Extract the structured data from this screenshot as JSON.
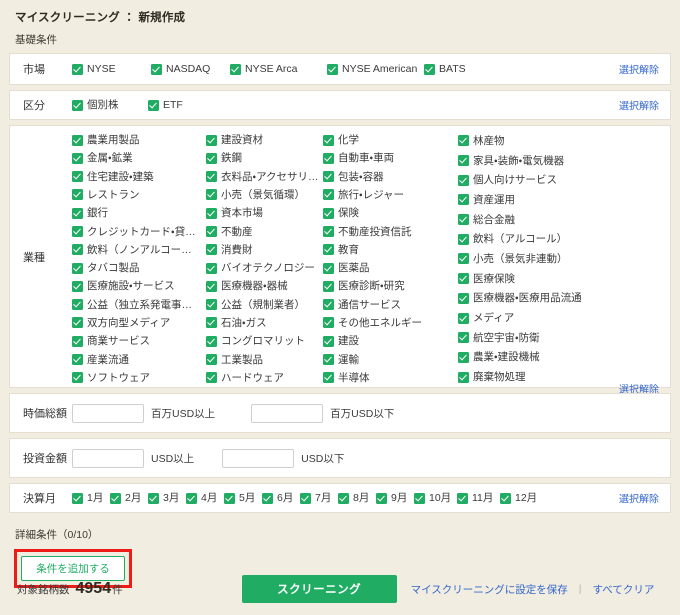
{
  "header": {
    "title": "マイスクリーニング ： 新規作成",
    "subtitle": "基礎条件"
  },
  "clear_link_label": "選択解除",
  "market": {
    "label": "市場",
    "items": [
      {
        "label": "NYSE",
        "checked": true
      },
      {
        "label": "NASDAQ",
        "checked": true
      },
      {
        "label": "NYSE Arca",
        "checked": true
      },
      {
        "label": "NYSE American",
        "checked": true
      },
      {
        "label": "BATS",
        "checked": true
      }
    ]
  },
  "kubun": {
    "label": "区分",
    "items": [
      {
        "label": "個別株",
        "checked": true
      },
      {
        "label": "ETF",
        "checked": true
      }
    ]
  },
  "industry": {
    "label": "業種",
    "columns": [
      [
        "農業用製品",
        "金属・鉱業",
        "住宅建設・建築",
        "レストラン",
        "銀行",
        "クレジットカード・貸…",
        "飲料（ノンアルコール）",
        "タバコ製品",
        "医療施設・サービス",
        "公益（独立系発電事業…",
        "双方向型メディア",
        "商業サービス",
        "産業流通",
        "ソフトウェア"
      ],
      [
        "建設資材",
        "鉄鋼",
        "衣料品・アクセサリー…",
        "小売（景気循環）",
        "資本市場",
        "不動産",
        "消費財",
        "バイオテクノロジー",
        "医療機器・器械",
        "公益（規制業者）",
        "石油・ガス",
        "コングロマリット",
        "工業製品",
        "ハードウェア"
      ],
      [
        "化学",
        "自動車・車両",
        "包装・容器",
        "旅行・レジャー",
        "保険",
        "不動産投資信託",
        "教育",
        "医薬品",
        "医療診断・研究",
        "通信サービス",
        "その他エネルギー",
        "建設",
        "運輸",
        "半導体"
      ],
      [
        "林産物",
        "家具・装飾・電気機器",
        "個人向けサービス",
        "資産運用",
        "総合金融",
        "飲料（アルコール）",
        "小売（景気非連動）",
        "医療保険",
        "医療機器・医療用品流通",
        "メディア",
        "航空宇宙・防衛",
        "農業・建設機械",
        "廃棄物処理"
      ]
    ]
  },
  "market_cap": {
    "label": "時価総額",
    "min_value": "",
    "min_placeholder": "",
    "min_unit": "百万USD以上",
    "max_value": "",
    "max_placeholder": "",
    "max_unit": "百万USD以下"
  },
  "investment": {
    "label": "投資金額",
    "min_value": "",
    "min_placeholder": "",
    "min_unit": "USD以上",
    "max_value": "",
    "max_placeholder": "",
    "max_unit": "USD以下"
  },
  "fiscal_month": {
    "label": "決算月",
    "items": [
      {
        "label": "1月",
        "checked": true
      },
      {
        "label": "2月",
        "checked": true
      },
      {
        "label": "3月",
        "checked": true
      },
      {
        "label": "4月",
        "checked": true
      },
      {
        "label": "5月",
        "checked": true
      },
      {
        "label": "6月",
        "checked": true
      },
      {
        "label": "7月",
        "checked": true
      },
      {
        "label": "8月",
        "checked": true
      },
      {
        "label": "9月",
        "checked": true
      },
      {
        "label": "10月",
        "checked": true
      },
      {
        "label": "11月",
        "checked": true
      },
      {
        "label": "12月",
        "checked": true
      }
    ]
  },
  "detail": {
    "heading": "詳細条件（0/10）",
    "add_button_label": "条件を追加する"
  },
  "footer": {
    "count_label": "対象銘柄数",
    "count_value": "4954",
    "count_unit": "件",
    "screening_button_label": "スクリーニング",
    "save_link_label": "マイスクリーニングに設定を保存",
    "separator": "|",
    "clear_all_link_label": "すべてクリア"
  },
  "colors": {
    "accent_green": "#21ac63",
    "link_blue": "#3366cc",
    "highlight_red": "#ee1c17",
    "page_background": "#f2ede1"
  }
}
